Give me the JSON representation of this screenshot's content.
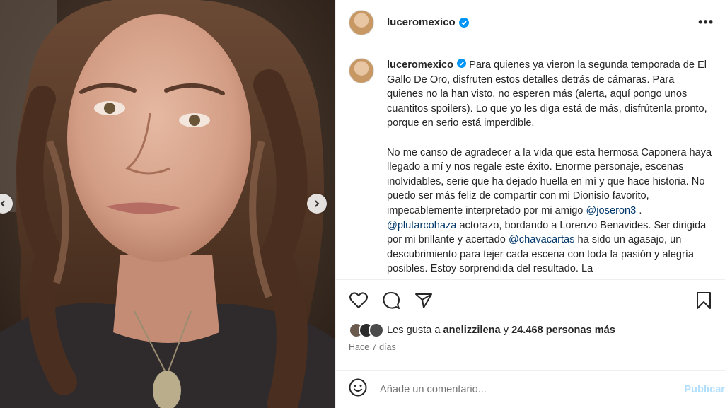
{
  "post": {
    "username": "luceromexico",
    "more_icon": "more-horizontal-icon",
    "caption_p1": "Para quienes ya vieron la segunda temporada de El Gallo De Oro, disfruten estos detalles detrás de cámaras. Para quienes no la han visto, no esperen más (alerta, aquí pongo unos cuantitos spoilers). Lo que yo les diga está de más, disfrútenla pronto, porque en serio está imperdible.",
    "caption_p2_a": "No me canso de agradecer a la vida que esta hermosa Caponera haya llegado a mí y nos regale este éxito. Enorme personaje, escenas inolvidables, serie que ha dejado huella en mí y que hace historia. No puedo ser más feliz de compartir con mi Dionisio favorito, impecablemente interpretado por mi amigo ",
    "mention_1": "@joseron3",
    "caption_p2_b": " . ",
    "mention_2": "@plutarcohaza",
    "caption_p2_c": " actorazo, bordando a Lorenzo Benavides. Ser dirigida por mi brillante y acertado ",
    "mention_3": "@chavacartas",
    "caption_p2_d": " ha sido un agasajo, un descubrimiento para tejer cada escena con toda la pasión y alegría posibles. Estoy sorprendida del resultado. La"
  },
  "likes": {
    "prefix": "Les gusta a ",
    "user": "anelizzilena",
    "middle": " y ",
    "count": "24.468 personas más"
  },
  "time_ago": "Hace 7 días",
  "comment": {
    "placeholder": "Añade un comentario...",
    "post_label": "Publicar"
  },
  "colors": {
    "link": "#00376b",
    "verified": "#0095f6",
    "post_disabled": "#b2dffc"
  }
}
